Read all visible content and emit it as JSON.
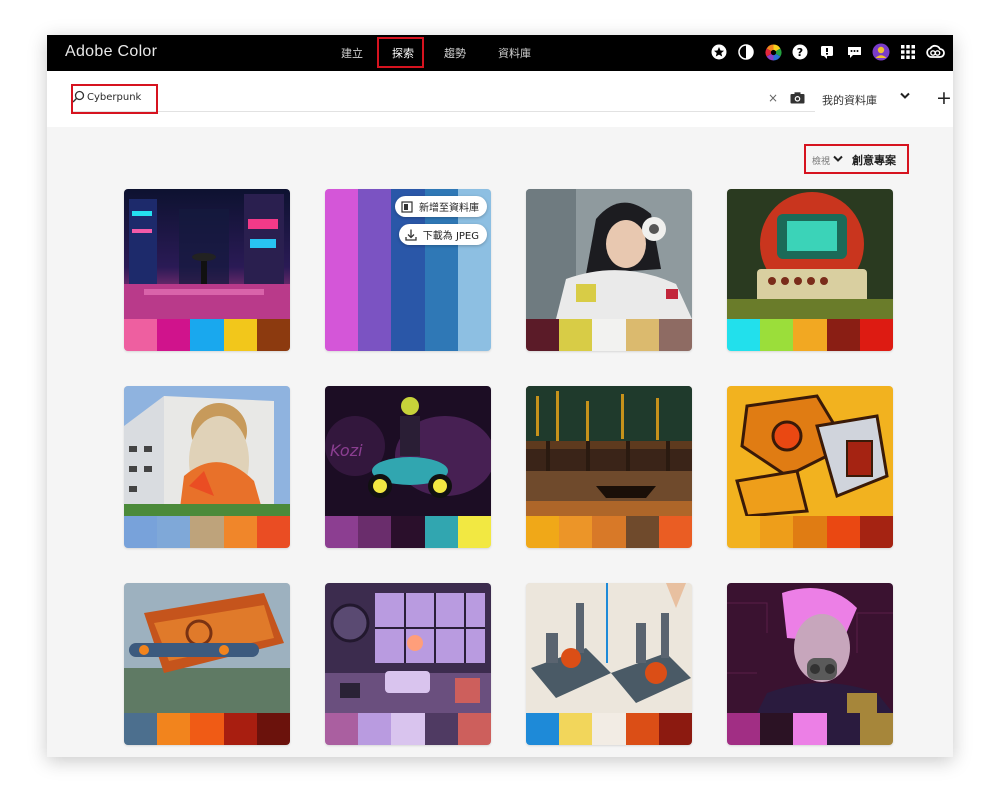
{
  "app": {
    "brand": "Adobe Color"
  },
  "nav": {
    "tabs": [
      {
        "label": "建立"
      },
      {
        "label": "探索"
      },
      {
        "label": "趨勢"
      },
      {
        "label": "資料庫"
      }
    ],
    "active": "探索"
  },
  "topbar_icons": [
    "star-circle-icon",
    "contrast-icon",
    "color-wheel-icon",
    "help-icon",
    "alert-icon",
    "chat-icon",
    "user-avatar-icon",
    "app-grid-icon",
    "creative-cloud-icon"
  ],
  "search": {
    "query": "Cyberpunk",
    "clear_label": "×",
    "library_label": "我的資料庫",
    "add_label": "+"
  },
  "sort": {
    "label": "檢視",
    "value": "創意專案"
  },
  "card_actions": {
    "add_to_library": "新增至資料庫",
    "download_jpeg": "下載為 JPEG"
  },
  "colors": {
    "highlight": "#d6131f",
    "topbar": "#000000",
    "canvas": "#f5f5f5"
  },
  "cards": [
    {
      "theme": "neon-rainy-street",
      "palette": [
        "#ee5fa0",
        "#d0138c",
        "#19a8ee",
        "#f2c71b",
        "#8c3a0f"
      ]
    },
    {
      "theme": "color-palette",
      "palette": [
        "#d456d8",
        "#7b53c2",
        "#2a57a8",
        "#2f78b6",
        "#8dbfe2"
      ]
    },
    {
      "theme": "cyber-girl-portrait",
      "palette": [
        "#5b1b28",
        "#d8cc46",
        "#f2f2f0",
        "#dbba6e",
        "#8e6b63"
      ]
    },
    {
      "theme": "retro-machine",
      "palette": [
        "#22e0ec",
        "#9bde3a",
        "#f2a822",
        "#8a1e14",
        "#dd1b12"
      ]
    },
    {
      "theme": "building-mural",
      "palette": [
        "#78a2da",
        "#7fa8d8",
        "#bea37b",
        "#f0862a",
        "#ea4d23"
      ]
    },
    {
      "theme": "cyber-bike-rider",
      "palette": [
        "#8c3e91",
        "#6a2d6c",
        "#2a0f2b",
        "#31a6b0",
        "#f2e842"
      ]
    },
    {
      "theme": "neon-harbor",
      "palette": [
        "#f0a818",
        "#ec9528",
        "#d87928",
        "#6f4a2c",
        "#ea5d23"
      ]
    },
    {
      "theme": "robot-warrior",
      "palette": [
        "#f2b21f",
        "#ee9e1a",
        "#e07c13",
        "#ea4812",
        "#a52312"
      ]
    },
    {
      "theme": "steampunk-ship",
      "palette": [
        "#4c6f8e",
        "#f2841d",
        "#f05b15",
        "#a81e10",
        "#6b120c"
      ]
    },
    {
      "theme": "synthwave-room",
      "palette": [
        "#aa5fa0",
        "#b99be0",
        "#d9c4ee",
        "#4f3a62",
        "#cd5f5c"
      ]
    },
    {
      "theme": "lava-castles",
      "palette": [
        "#1e8ad8",
        "#f2d65b",
        "#f2ece4",
        "#db4e16",
        "#8c1a10"
      ]
    },
    {
      "theme": "gas-mask-portrait",
      "palette": [
        "#a12e84",
        "#2b1224",
        "#ec7fe6",
        "#2a1b3e",
        "#a6863a"
      ]
    }
  ]
}
